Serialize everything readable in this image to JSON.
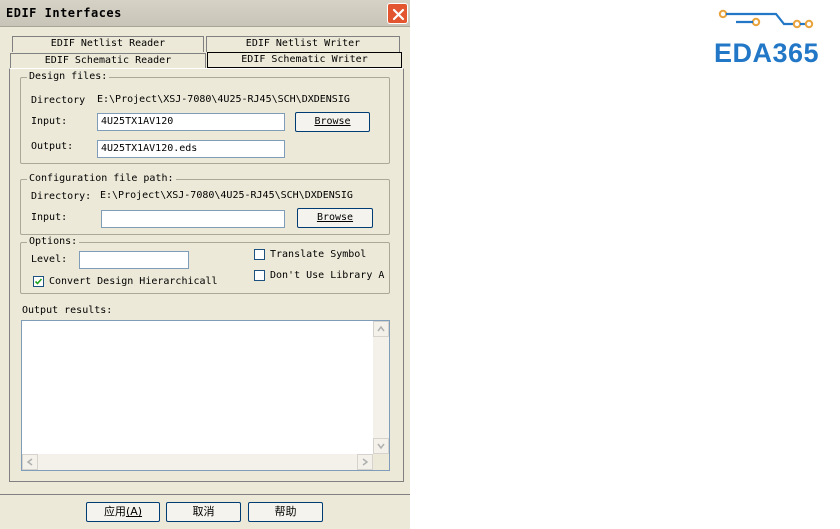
{
  "window": {
    "title": "EDIF Interfaces",
    "close_icon": "close-icon"
  },
  "tabs": [
    {
      "label": "EDIF Netlist Reader",
      "active": false
    },
    {
      "label": "EDIF Netlist Writer",
      "active": false
    },
    {
      "label": "EDIF Schematic Reader",
      "active": false
    },
    {
      "label": "EDIF Schematic Writer",
      "active": true
    }
  ],
  "design_files": {
    "legend": "Design files:",
    "directory_label": "Directory",
    "directory_value": "E:\\Project\\XSJ-7080\\4U25-RJ45\\SCH\\DXDENSIG",
    "input_label": "Input:",
    "input_value": "4U25TX1AV120",
    "browse_label": "Browse",
    "output_label": "Output:",
    "output_value": "4U25TX1AV120.eds"
  },
  "config_file": {
    "legend": "Configuration file path:",
    "directory_label": "Directory:",
    "directory_value": "E:\\Project\\XSJ-7080\\4U25-RJ45\\SCH\\DXDENSIG",
    "input_label": "Input:",
    "input_value": "",
    "browse_label": "Browse"
  },
  "options": {
    "legend": "Options:",
    "level_label": "Level:",
    "level_value": "",
    "convert_label": "Convert Design Hierarchicall",
    "convert_checked": true,
    "translate_label": "Translate Symbol",
    "translate_checked": false,
    "library_label": "Don't Use Library A",
    "library_checked": false
  },
  "output_results": {
    "label": "Output results:",
    "text": ""
  },
  "footer": {
    "apply_label": "应用",
    "apply_key": "(A)",
    "cancel_label": "取消",
    "help_label": "帮助"
  },
  "logo": {
    "text": "EDA365",
    "color": "#2277c7",
    "accent": "#e8a33c"
  }
}
